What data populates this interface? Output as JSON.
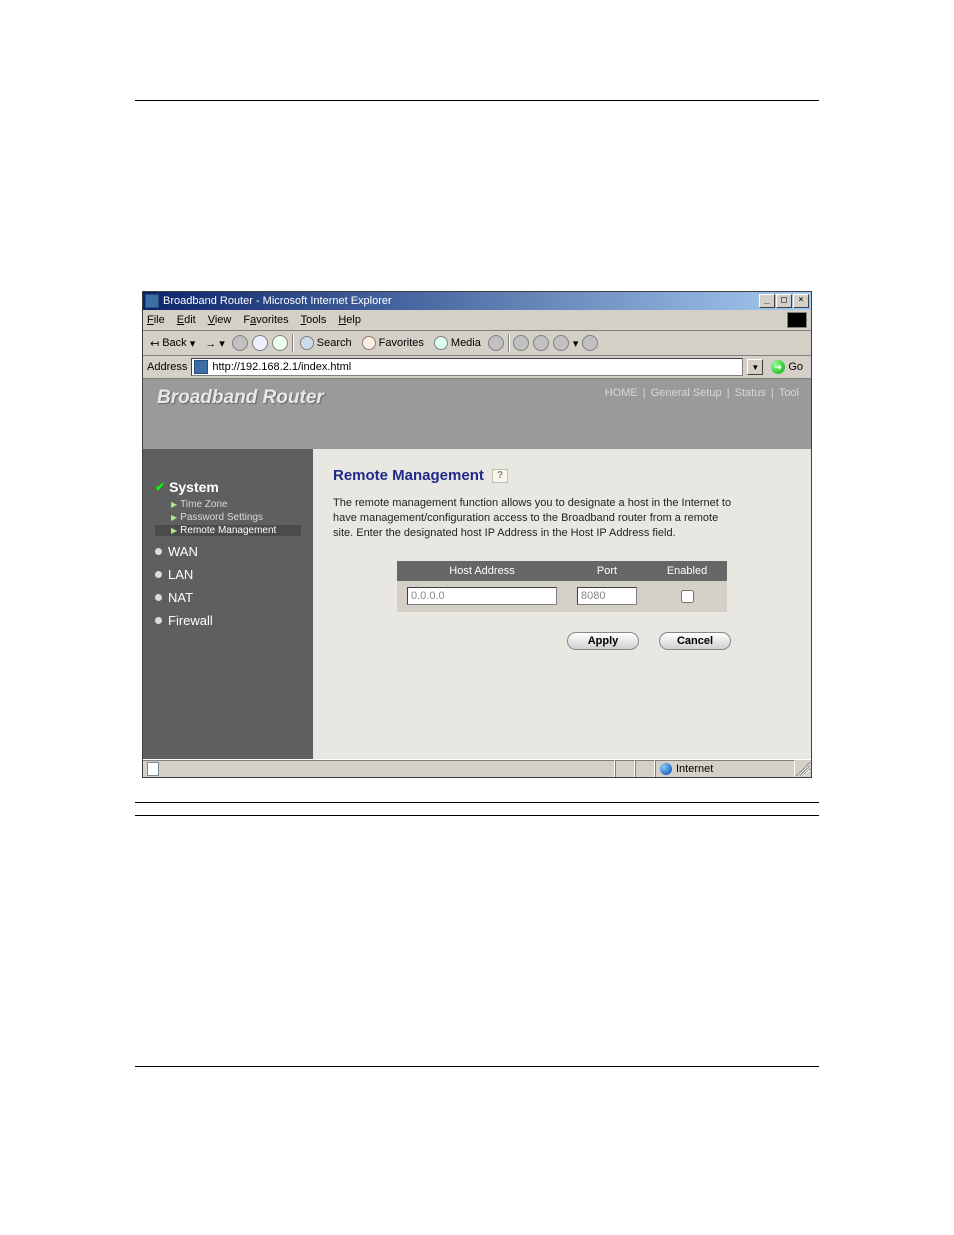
{
  "window": {
    "title": "Broadband Router - Microsoft Internet Explorer",
    "min": "_",
    "max": "□",
    "close": "×"
  },
  "menus": {
    "file": "File",
    "edit": "Edit",
    "view": "View",
    "favorites": "Favorites",
    "tools": "Tools",
    "help": "Help"
  },
  "toolbar": {
    "back": "Back",
    "search": "Search",
    "favorites": "Favorites",
    "media": "Media"
  },
  "address": {
    "label": "Address",
    "value": "http://192.168.2.1/index.html",
    "go": "Go"
  },
  "banner": {
    "brand": "Broadband Router",
    "links": [
      "HOME",
      "General Setup",
      "Status",
      "Tool"
    ]
  },
  "sidebar": {
    "system_label": "System",
    "subs": [
      "Time Zone",
      "Password Settings",
      "Remote Management"
    ],
    "items": [
      "WAN",
      "LAN",
      "NAT",
      "Firewall"
    ]
  },
  "page": {
    "heading": "Remote Management",
    "help": "?",
    "description": "The remote management function allows you to designate a host in the Internet to have management/configuration access to the Broadband router from a remote site. Enter the designated host IP Address in the Host IP Address field.",
    "table": {
      "headers": [
        "Host Address",
        "Port",
        "Enabled"
      ],
      "host_value": "0.0.0.0",
      "port_value": "8080"
    },
    "buttons": {
      "apply": "Apply",
      "cancel": "Cancel"
    }
  },
  "status": {
    "zone": "Internet"
  }
}
